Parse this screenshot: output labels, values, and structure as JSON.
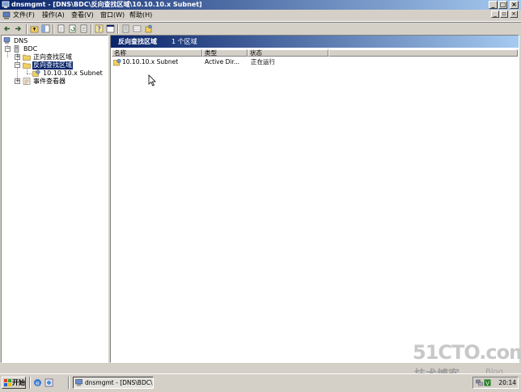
{
  "window": {
    "title": "dnsmgmt - [DNS\\BDC\\反向查找区域\\10.10.10.x Subnet]"
  },
  "menu": {
    "items": [
      "文件(F)",
      "操作(A)",
      "查看(V)",
      "窗口(W)",
      "帮助(H)"
    ]
  },
  "toolbar": {
    "buttons": [
      "back",
      "forward",
      "up-folder",
      "show-tree",
      "properties",
      "refresh",
      "export-list",
      "help",
      "console",
      "list-view",
      "detail-view",
      "new-zone"
    ]
  },
  "tree": {
    "root": "DNS",
    "server": "BDC",
    "forward_zones": "正向查找区域",
    "reverse_zones": "反向查找区域",
    "subnet": "10.10.10.x Subnet",
    "event_viewer": "事件查看器",
    "expander_plus": "+",
    "expander_minus": "−"
  },
  "right_panel": {
    "header_title": "反向查找区域",
    "header_count": "1 个区域",
    "columns": [
      "名称",
      "类型",
      "状态"
    ],
    "rows": [
      {
        "name": "10.10.10.x Subnet",
        "type": "Active Dir...",
        "status": "正在运行"
      }
    ]
  },
  "watermark": {
    "site": "51CTO.com",
    "tagline": "技术博客",
    "blog": "Blog"
  },
  "taskbar": {
    "start_label": "开始",
    "task_label": "dnsmgmt - [DNS\\BDC\\...",
    "clock": "20:14"
  },
  "colors": {
    "title_start": "#0a246a",
    "title_end": "#a6caf0",
    "selection": "#0a246a",
    "chrome": "#d4d0c8"
  }
}
